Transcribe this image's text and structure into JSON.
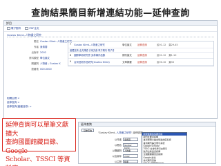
{
  "heading": "查詢結果簡目新增連結功能—延伸查詢",
  "top": {
    "window_title": "詳目",
    "toolbar": [
      {
        "icon": "envelope-icon",
        "label": "電子郵件"
      },
      {
        "icon": "document-icon",
        "label": "PDF全文"
      }
    ],
    "record_title": "Gustav Klimt--人物畫之研究",
    "fields": [
      {
        "label": "題名",
        "value": "Gustav Klimt--人物畫之研究"
      },
      {
        "label": "作者",
        "value": "吳佩蓉"
      },
      {
        "label": "出版年",
        "value": "2002"
      },
      {
        "label": "資料類型",
        "value": "學位論文"
      },
      {
        "label": "關鍵詞",
        "value": "人物畫 ; Gustav K"
      },
      {
        "label": "館藏地",
        "value": "000.0000"
      }
    ],
    "results": [
      {
        "num": "7",
        "title": "Gustav Klimt--人物畫之研究",
        "type": "學位論文",
        "link": "延伸查詢",
        "date": "民91.12",
        "extra": "頁29-45"
      },
      {
        "num": "8",
        "title": "國際學術研究會 克林姆作品集",
        "type": "期刊論文",
        "link": "延伸查詢",
        "date": "民91.12",
        "extra": "頁1-10"
      },
      {
        "num": "9",
        "title": "台灣藝術作品研究(Gustav Klimt)",
        "type": "文章摘要",
        "link": "延伸查詢",
        "date": "民90.10",
        "extra": "頁33"
      }
    ],
    "result_sublinks": [
      "館藏查詢 全文傳遞 引用文獻 電子期刊 電子書"
    ],
    "side_links": [
      "相關主題 >",
      "延伸查詢 >",
      "延伸查詢(館藏目錄) >"
    ]
  },
  "callout": "延伸查詢可以單筆文獻擴大\n查詢國圖館藏目錄、Google\nScholar、TSSCI 等資料庫",
  "bottom": {
    "window_title": "延伸查詢",
    "button_label": "延伸查詢",
    "path_prefix": "'Gustav Klimt--",
    "path_title": "人物畫之研究",
    "path_suffix": "' 延伸查詢",
    "search_rows": [
      {
        "label": "以作者",
        "value": "吳佩蓉"
      },
      {
        "label": "以題名",
        "value": "Gustav Klimt"
      },
      {
        "label": "以關鍵詞",
        "value": "人物畫"
      },
      {
        "label": "以出版年",
        "value": "2002"
      },
      {
        "label": "以主題",
        "value": "繪畫"
      }
    ],
    "options": [
      "國家圖書館館藏目錄",
      "期刊文獻資訊網",
      "臺灣博碩士論文知識加值系統",
      "臺灣期刊論文索引系統",
      "Google Scholar",
      "TSSCI 社會科學引文索引",
      "政府出版品資訊網",
      "全國圖書書目資訊網",
      "Google 搜尋",
      "當代期刊目錄",
      "NDLTD 國際學位論文",
      "其他資料庫"
    ],
    "selected_index": 0
  }
}
